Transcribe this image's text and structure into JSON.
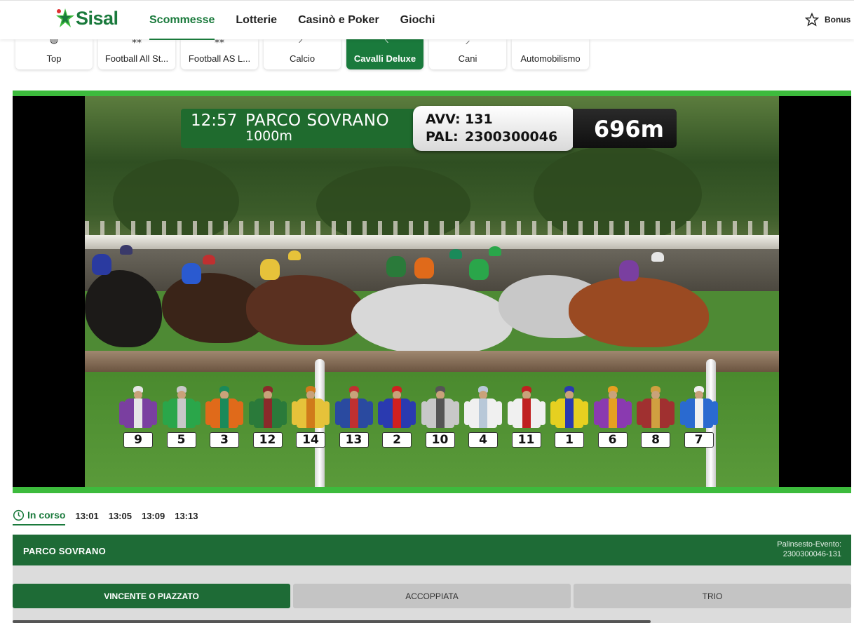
{
  "header": {
    "logo": "Sisal",
    "nav": [
      "Scommesse",
      "Lotterie",
      "Casinò e Poker",
      "Giochi"
    ],
    "active_nav": "Scommesse",
    "bonus_label": "Bonus"
  },
  "categories": [
    {
      "label": "Top",
      "icon": "trophy-icon"
    },
    {
      "label": "Football All St...",
      "icon": "stars-icon"
    },
    {
      "label": "Football AS L...",
      "icon": "stars-icon"
    },
    {
      "label": "Calcio",
      "icon": "football-icon"
    },
    {
      "label": "Cavalli Deluxe",
      "icon": "horse-icon",
      "active": true
    },
    {
      "label": "Cani",
      "icon": "dog-icon"
    },
    {
      "label": "Automobilismo",
      "icon": "car-icon"
    }
  ],
  "video": {
    "time": "12:57",
    "track": "PARCO SOVRANO",
    "distance_race": "1000m",
    "avv_label": "AVV:",
    "avv_value": "131",
    "pal_label": "PAL:",
    "pal_value": "2300300046",
    "distance_remaining": "696m",
    "runners": [
      {
        "num": "9",
        "colors": [
          "#7a3fa0",
          "#e6e6e6"
        ]
      },
      {
        "num": "5",
        "colors": [
          "#2aa64a",
          "#c8c8c8"
        ]
      },
      {
        "num": "3",
        "colors": [
          "#e06a1a",
          "#1a8a5a"
        ]
      },
      {
        "num": "12",
        "colors": [
          "#2a7a3a",
          "#8a2a2a"
        ]
      },
      {
        "num": "14",
        "colors": [
          "#e6c23a",
          "#d07a1a"
        ]
      },
      {
        "num": "13",
        "colors": [
          "#2a4aa0",
          "#c03030"
        ]
      },
      {
        "num": "2",
        "colors": [
          "#2a3ab0",
          "#d02020"
        ]
      },
      {
        "num": "10",
        "colors": [
          "#c8c8c8",
          "#555555"
        ]
      },
      {
        "num": "4",
        "colors": [
          "#f0f0f0",
          "#b8c8d8"
        ]
      },
      {
        "num": "11",
        "colors": [
          "#f0f0f0",
          "#c02020"
        ]
      },
      {
        "num": "1",
        "colors": [
          "#e6d020",
          "#2a3ab0"
        ]
      },
      {
        "num": "6",
        "colors": [
          "#8a3ab0",
          "#e6a020"
        ]
      },
      {
        "num": "8",
        "colors": [
          "#a03030",
          "#d0a040"
        ]
      },
      {
        "num": "7",
        "colors": [
          "#2a6ad0",
          "#f0f0f0"
        ]
      }
    ]
  },
  "time_tabs": {
    "active": "In corso",
    "others": [
      "13:01",
      "13:05",
      "13:09",
      "13:13"
    ]
  },
  "event": {
    "name": "PARCO SOVRANO",
    "meta_label": "Palinsesto-Evento:",
    "meta_value": "2300300046-131"
  },
  "bet_tabs": [
    "VINCENTE O PIAZZATO",
    "ACCOPPIATA",
    "TRIO"
  ],
  "colors": {
    "brand": "#1a7a3c",
    "video_border": "#3dbb3d",
    "event_bar": "#1e6b36"
  }
}
